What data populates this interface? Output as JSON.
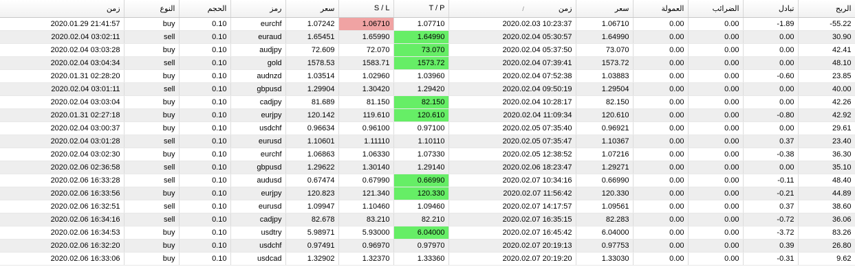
{
  "headers": {
    "time_open": "زمن",
    "type": "النوع",
    "volume": "الحجم",
    "symbol": "رمز",
    "price_open": "سعر",
    "sl": "S / L",
    "tp": "T / P",
    "time_close": "زمن",
    "sort_indicator": "/",
    "price_close": "سعر",
    "commission": "العمولة",
    "taxes": "الضرائب",
    "swap": "تبادل",
    "profit": "الربح"
  },
  "colors": {
    "tp_hit": "#66ee66",
    "sl_hit": "#f0a3a3"
  },
  "rows": [
    {
      "time_open": "2020.01.29 21:41:57",
      "type": "buy",
      "volume": "0.10",
      "symbol": "eurchf",
      "price_open": "1.07242",
      "sl": "1.06710",
      "tp": "1.07710",
      "time_close": "2020.02.03 10:23:37",
      "price_close": "1.06710",
      "commission": "0.00",
      "taxes": "0.00",
      "swap": "-1.89",
      "profit": "-55.22",
      "hit": "sl"
    },
    {
      "time_open": "2020.02.04 03:02:11",
      "type": "sell",
      "volume": "0.10",
      "symbol": "euraud",
      "price_open": "1.65451",
      "sl": "1.65990",
      "tp": "1.64990",
      "time_close": "2020.02.04 05:30:57",
      "price_close": "1.64990",
      "commission": "0.00",
      "taxes": "0.00",
      "swap": "0.00",
      "profit": "30.90",
      "hit": "tp"
    },
    {
      "time_open": "2020.02.04 03:03:28",
      "type": "buy",
      "volume": "0.10",
      "symbol": "audjpy",
      "price_open": "72.609",
      "sl": "72.070",
      "tp": "73.070",
      "time_close": "2020.02.04 05:37:50",
      "price_close": "73.070",
      "commission": "0.00",
      "taxes": "0.00",
      "swap": "0.00",
      "profit": "42.41",
      "hit": "tp"
    },
    {
      "time_open": "2020.02.04 03:04:34",
      "type": "sell",
      "volume": "0.10",
      "symbol": "gold",
      "price_open": "1578.53",
      "sl": "1583.71",
      "tp": "1573.72",
      "time_close": "2020.02.04 07:39:41",
      "price_close": "1573.72",
      "commission": "0.00",
      "taxes": "0.00",
      "swap": "0.00",
      "profit": "48.10",
      "hit": "tp"
    },
    {
      "time_open": "2020.01.31 02:28:20",
      "type": "buy",
      "volume": "0.10",
      "symbol": "audnzd",
      "price_open": "1.03514",
      "sl": "1.02960",
      "tp": "1.03960",
      "time_close": "2020.02.04 07:52:38",
      "price_close": "1.03883",
      "commission": "0.00",
      "taxes": "0.00",
      "swap": "-0.60",
      "profit": "23.85",
      "hit": ""
    },
    {
      "time_open": "2020.02.04 03:01:11",
      "type": "sell",
      "volume": "0.10",
      "symbol": "gbpusd",
      "price_open": "1.29904",
      "sl": "1.30420",
      "tp": "1.29420",
      "time_close": "2020.02.04 09:50:19",
      "price_close": "1.29504",
      "commission": "0.00",
      "taxes": "0.00",
      "swap": "0.00",
      "profit": "40.00",
      "hit": ""
    },
    {
      "time_open": "2020.02.04 03:03:04",
      "type": "buy",
      "volume": "0.10",
      "symbol": "cadjpy",
      "price_open": "81.689",
      "sl": "81.150",
      "tp": "82.150",
      "time_close": "2020.02.04 10:28:17",
      "price_close": "82.150",
      "commission": "0.00",
      "taxes": "0.00",
      "swap": "0.00",
      "profit": "42.26",
      "hit": "tp"
    },
    {
      "time_open": "2020.01.31 02:27:18",
      "type": "buy",
      "volume": "0.10",
      "symbol": "eurjpy",
      "price_open": "120.142",
      "sl": "119.610",
      "tp": "120.610",
      "time_close": "2020.02.04 11:09:34",
      "price_close": "120.610",
      "commission": "0.00",
      "taxes": "0.00",
      "swap": "-0.80",
      "profit": "42.92",
      "hit": "tp"
    },
    {
      "time_open": "2020.02.04 03:00:37",
      "type": "buy",
      "volume": "0.10",
      "symbol": "usdchf",
      "price_open": "0.96634",
      "sl": "0.96100",
      "tp": "0.97100",
      "time_close": "2020.02.05 07:35:40",
      "price_close": "0.96921",
      "commission": "0.00",
      "taxes": "0.00",
      "swap": "0.00",
      "profit": "29.61",
      "hit": ""
    },
    {
      "time_open": "2020.02.04 03:01:28",
      "type": "sell",
      "volume": "0.10",
      "symbol": "eurusd",
      "price_open": "1.10601",
      "sl": "1.11110",
      "tp": "1.10110",
      "time_close": "2020.02.05 07:35:47",
      "price_close": "1.10367",
      "commission": "0.00",
      "taxes": "0.00",
      "swap": "0.37",
      "profit": "23.40",
      "hit": ""
    },
    {
      "time_open": "2020.02.04 03:02:30",
      "type": "buy",
      "volume": "0.10",
      "symbol": "eurchf",
      "price_open": "1.06863",
      "sl": "1.06330",
      "tp": "1.07330",
      "time_close": "2020.02.05 12:38:52",
      "price_close": "1.07216",
      "commission": "0.00",
      "taxes": "0.00",
      "swap": "-0.38",
      "profit": "36.30",
      "hit": ""
    },
    {
      "time_open": "2020.02.06 02:36:58",
      "type": "sell",
      "volume": "0.10",
      "symbol": "gbpusd",
      "price_open": "1.29622",
      "sl": "1.30140",
      "tp": "1.29140",
      "time_close": "2020.02.06 18:23:47",
      "price_close": "1.29271",
      "commission": "0.00",
      "taxes": "0.00",
      "swap": "0.00",
      "profit": "35.10",
      "hit": ""
    },
    {
      "time_open": "2020.02.06 16:33:28",
      "type": "sell",
      "volume": "0.10",
      "symbol": "audusd",
      "price_open": "0.67474",
      "sl": "0.67990",
      "tp": "0.66990",
      "time_close": "2020.02.07 10:34:16",
      "price_close": "0.66990",
      "commission": "0.00",
      "taxes": "0.00",
      "swap": "-0.11",
      "profit": "48.40",
      "hit": "tp"
    },
    {
      "time_open": "2020.02.06 16:33:56",
      "type": "buy",
      "volume": "0.10",
      "symbol": "eurjpy",
      "price_open": "120.823",
      "sl": "121.340",
      "tp": "120.330",
      "time_close": "2020.02.07 11:56:42",
      "price_close": "120.330",
      "commission": "0.00",
      "taxes": "0.00",
      "swap": "-0.21",
      "profit": "44.89",
      "hit": "tp"
    },
    {
      "time_open": "2020.02.06 16:32:51",
      "type": "sell",
      "volume": "0.10",
      "symbol": "eurusd",
      "price_open": "1.09947",
      "sl": "1.10460",
      "tp": "1.09460",
      "time_close": "2020.02.07 14:17:57",
      "price_close": "1.09561",
      "commission": "0.00",
      "taxes": "0.00",
      "swap": "0.37",
      "profit": "38.60",
      "hit": ""
    },
    {
      "time_open": "2020.02.06 16:34:16",
      "type": "sell",
      "volume": "0.10",
      "symbol": "cadjpy",
      "price_open": "82.678",
      "sl": "83.210",
      "tp": "82.210",
      "time_close": "2020.02.07 16:35:15",
      "price_close": "82.283",
      "commission": "0.00",
      "taxes": "0.00",
      "swap": "-0.72",
      "profit": "36.06",
      "hit": ""
    },
    {
      "time_open": "2020.02.06 16:34:53",
      "type": "buy",
      "volume": "0.10",
      "symbol": "usdtry",
      "price_open": "5.98971",
      "sl": "5.93000",
      "tp": "6.04000",
      "time_close": "2020.02.07 16:45:42",
      "price_close": "6.04000",
      "commission": "0.00",
      "taxes": "0.00",
      "swap": "-3.72",
      "profit": "83.26",
      "hit": "tp"
    },
    {
      "time_open": "2020.02.06 16:32:20",
      "type": "buy",
      "volume": "0.10",
      "symbol": "usdchf",
      "price_open": "0.97491",
      "sl": "0.96970",
      "tp": "0.97970",
      "time_close": "2020.02.07 20:19:13",
      "price_close": "0.97753",
      "commission": "0.00",
      "taxes": "0.00",
      "swap": "0.39",
      "profit": "26.80",
      "hit": ""
    },
    {
      "time_open": "2020.02.06 16:33:06",
      "type": "buy",
      "volume": "0.10",
      "symbol": "usdcad",
      "price_open": "1.32902",
      "sl": "1.32370",
      "tp": "1.33360",
      "time_close": "2020.02.07 20:19:20",
      "price_close": "1.33030",
      "commission": "0.00",
      "taxes": "0.00",
      "swap": "-0.31",
      "profit": "9.62",
      "hit": ""
    }
  ]
}
